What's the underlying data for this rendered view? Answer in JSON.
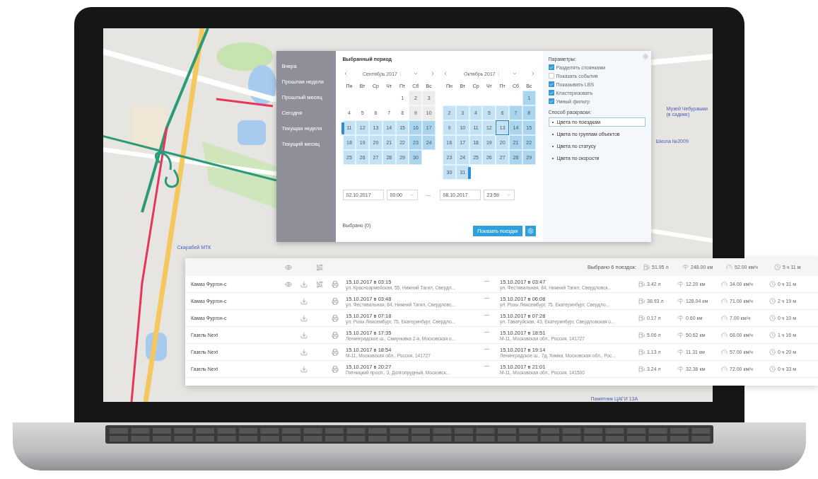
{
  "map": {
    "labels": [
      "Скарабей МТК",
      "Музей Чебурашки (в садике)",
      "Школа №2009",
      "Памятник ЦАГИ 13А"
    ]
  },
  "period_dialog": {
    "quick_ranges": [
      "Вчера",
      "Прошлая неделя",
      "Прошлый месяц",
      "Сегодня",
      "Текущая неделя",
      "Текущий месяц"
    ],
    "title": "Выбранный период",
    "months": [
      {
        "label": "Сентябрь 2017",
        "weekdays": [
          "Пн",
          "Вт",
          "Ср",
          "Чт",
          "Пт",
          "Сб",
          "Вс"
        ],
        "weeks": [
          [
            {
              "label": "1",
              "in_range": false,
              "today": false
            },
            {
              "label": "2",
              "in_range": false,
              "today": false
            },
            {
              "label": "3",
              "in_range": false,
              "today": false
            }
          ],
          [
            {
              "label": "4",
              "in_range": false,
              "today": false
            },
            {
              "label": "5",
              "in_range": false,
              "today": false
            },
            {
              "label": "6",
              "in_range": false,
              "today": false
            },
            {
              "label": "7",
              "in_range": false,
              "today": false
            },
            {
              "label": "8",
              "in_range": false,
              "today": false
            },
            {
              "label": "9",
              "in_range": false,
              "today": false
            },
            {
              "label": "10",
              "in_range": false,
              "today": false
            }
          ],
          [
            {
              "label": "11",
              "in_range": true,
              "today": false
            },
            {
              "label": "12",
              "in_range": true,
              "today": false
            },
            {
              "label": "13",
              "in_range": true,
              "today": false
            },
            {
              "label": "14",
              "in_range": true,
              "today": false
            },
            {
              "label": "15",
              "in_range": true,
              "today": false
            },
            {
              "label": "16",
              "in_range": true,
              "today": false
            },
            {
              "label": "17",
              "in_range": true,
              "today": false
            }
          ],
          [
            {
              "label": "18",
              "in_range": true,
              "today": false
            },
            {
              "label": "19",
              "in_range": true,
              "today": false
            },
            {
              "label": "20",
              "in_range": true,
              "today": false
            },
            {
              "label": "21",
              "in_range": true,
              "today": false
            },
            {
              "label": "22",
              "in_range": true,
              "today": false
            },
            {
              "label": "23",
              "in_range": true,
              "today": false
            },
            {
              "label": "24",
              "in_range": true,
              "today": false
            }
          ],
          [
            {
              "label": "25",
              "in_range": true,
              "today": false
            },
            {
              "label": "26",
              "in_range": true,
              "today": false
            },
            {
              "label": "27",
              "in_range": true,
              "today": false
            },
            {
              "label": "28",
              "in_range": true,
              "today": false
            },
            {
              "label": "29",
              "in_range": true,
              "today": false
            },
            {
              "label": "30",
              "in_range": true,
              "today": false
            }
          ]
        ]
      },
      {
        "label": "Октябрь 2017",
        "weekdays": [
          "Пн",
          "Вт",
          "Ср",
          "Чт",
          "Пт",
          "Сб",
          "Вс"
        ],
        "weeks": [
          [
            {
              "label": "1",
              "in_range": true,
              "today": false
            }
          ],
          [
            {
              "label": "2",
              "in_range": true,
              "today": false
            },
            {
              "label": "3",
              "in_range": true,
              "today": false
            },
            {
              "label": "4",
              "in_range": true,
              "today": false
            },
            {
              "label": "5",
              "in_range": true,
              "today": false
            },
            {
              "label": "6",
              "in_range": true,
              "today": false
            },
            {
              "label": "7",
              "in_range": true,
              "today": false
            },
            {
              "label": "8",
              "in_range": true,
              "today": false
            }
          ],
          [
            {
              "label": "9",
              "in_range": true,
              "today": false
            },
            {
              "label": "10",
              "in_range": true,
              "today": false
            },
            {
              "label": "11",
              "in_range": true,
              "today": false
            },
            {
              "label": "12",
              "in_range": true,
              "today": false
            },
            {
              "label": "13",
              "in_range": true,
              "today": true
            },
            {
              "label": "14",
              "in_range": true,
              "today": false
            },
            {
              "label": "15",
              "in_range": true,
              "today": false
            }
          ],
          [
            {
              "label": "16",
              "in_range": true,
              "today": false
            },
            {
              "label": "17",
              "in_range": true,
              "today": false
            },
            {
              "label": "18",
              "in_range": true,
              "today": false
            },
            {
              "label": "19",
              "in_range": true,
              "today": false
            },
            {
              "label": "20",
              "in_range": true,
              "today": false
            },
            {
              "label": "21",
              "in_range": true,
              "today": false
            },
            {
              "label": "22",
              "in_range": true,
              "today": false
            }
          ],
          [
            {
              "label": "23",
              "in_range": true,
              "today": false
            },
            {
              "label": "24",
              "in_range": true,
              "today": false
            },
            {
              "label": "25",
              "in_range": true,
              "today": false
            },
            {
              "label": "26",
              "in_range": true,
              "today": false
            },
            {
              "label": "27",
              "in_range": true,
              "today": false
            },
            {
              "label": "28",
              "in_range": true,
              "today": false
            },
            {
              "label": "29",
              "in_range": true,
              "today": false
            }
          ],
          [
            {
              "label": "30",
              "in_range": true,
              "today": false
            },
            {
              "label": "31",
              "in_range": true,
              "today": false
            }
          ]
        ]
      }
    ],
    "from_date": "02.10.2017",
    "from_time": "00:00",
    "separator": "—",
    "to_date": "08.10.2017",
    "to_time": "23:59",
    "selected_count": "Выбрано (0)",
    "show_button": "Показать поездки",
    "parameters_title": "Параметры:",
    "parameters": [
      {
        "label": "Разделять стоянками",
        "checked": true
      },
      {
        "label": "Показать события",
        "checked": false
      },
      {
        "label": "Показывать LBS",
        "checked": true
      },
      {
        "label": "Кластеризовать",
        "checked": true
      },
      {
        "label": "Умный фильтр",
        "checked": true
      }
    ],
    "coloring_title": "Способ раскраски:",
    "coloring": [
      {
        "label": "Цвета по поездкам",
        "selected": true
      },
      {
        "label": "Цвета по группам объектов",
        "selected": false
      },
      {
        "label": "Цвета по статусу",
        "selected": false
      },
      {
        "label": "Цвета по скорости",
        "selected": false
      }
    ]
  },
  "trips": {
    "summary": "Выбрано 6 поездок:",
    "total_fuel": "51.95 л",
    "total_distance": "248.00 км",
    "total_speed": "52.00 км/ч",
    "total_duration": "5 ч 11 м",
    "rows": [
      {
        "vehicle": "Камаз Фургон-с",
        "tracked": true,
        "start_time": "15.10.2017 в 03:15",
        "start_address": "ул. Красноармейская, 55, Нижний Тагил, Свердл...",
        "dash": "—",
        "end_time": "15.10.2017 в 03:47",
        "end_address": "ул. Фестивальная, 84, Нижний Тагил, Свердловск...",
        "fuel": "3.42 л",
        "distance": "12.20 км",
        "speed": "34.00 км/ч",
        "duration": "0 ч 31 м"
      },
      {
        "vehicle": "Камаз Фургон-с",
        "tracked": false,
        "start_time": "15.10.2017 в 03:48",
        "start_address": "ул. Фестивальная, 84, Нижний Тагил, Свердловс...",
        "dash": "—",
        "end_time": "15.10.2017 в 06:08",
        "end_address": "ул. Розы Люксембург, 75, Екатеринбург, Свердло...",
        "fuel": "38.93 л",
        "distance": "128.04 км",
        "speed": "71.00 км/ч",
        "duration": "2 ч 19 м"
      },
      {
        "vehicle": "Камаз Фургон-с",
        "tracked": false,
        "start_time": "15.10.2017 в 07:18",
        "start_address": "ул. Розы Люксембург, 75, Екатеринбург, Свердло...",
        "dash": "—",
        "end_time": "15.10.2017 в 07:28",
        "end_address": "ул. Таватуйская, 43, Екатеринбург, Свердловская о...",
        "fuel": "0.17 л",
        "distance": "0.60 км",
        "speed": "7.00 км/ч",
        "duration": "0 ч 10 м"
      },
      {
        "vehicle": "Газель Next",
        "tracked": false,
        "start_time": "15.10.2017 в 17:35",
        "start_address": "Ленинградское ш., Смирновка 2-я, Московская о...",
        "dash": "—",
        "end_time": "15.10.2017 в 18:51",
        "end_address": "М-11, Московская обл., Россия, 141727",
        "fuel": "5.06 л",
        "distance": "50.62 км",
        "speed": "68.00 км/ч",
        "duration": "1 ч 16 м"
      },
      {
        "vehicle": "Газель Next",
        "tracked": false,
        "start_time": "15.10.2017 в 18:54",
        "start_address": "М-11, Московская обл., Россия, 141727",
        "dash": "—",
        "end_time": "15.10.2017 в 19:14",
        "end_address": "Ленинградское ш., 7д, Химки, Московская обл., Рос...",
        "fuel": "1.13 л",
        "distance": "11.31 км",
        "speed": "57.00 км/ч",
        "duration": "0 ч 20 м"
      },
      {
        "vehicle": "Газель Next",
        "tracked": false,
        "start_time": "15.10.2017 в 20:27",
        "start_address": "Пятницкий просп., 3, Долгопрудный, Московск...",
        "dash": "—",
        "end_time": "15.10.2017 в 21:01",
        "end_address": "М-11, Московская обл., Россия, 141500",
        "fuel": "3.24 л",
        "distance": "32.36 км",
        "speed": "72.00 км/ч",
        "duration": "0 ч 33 м"
      }
    ]
  }
}
